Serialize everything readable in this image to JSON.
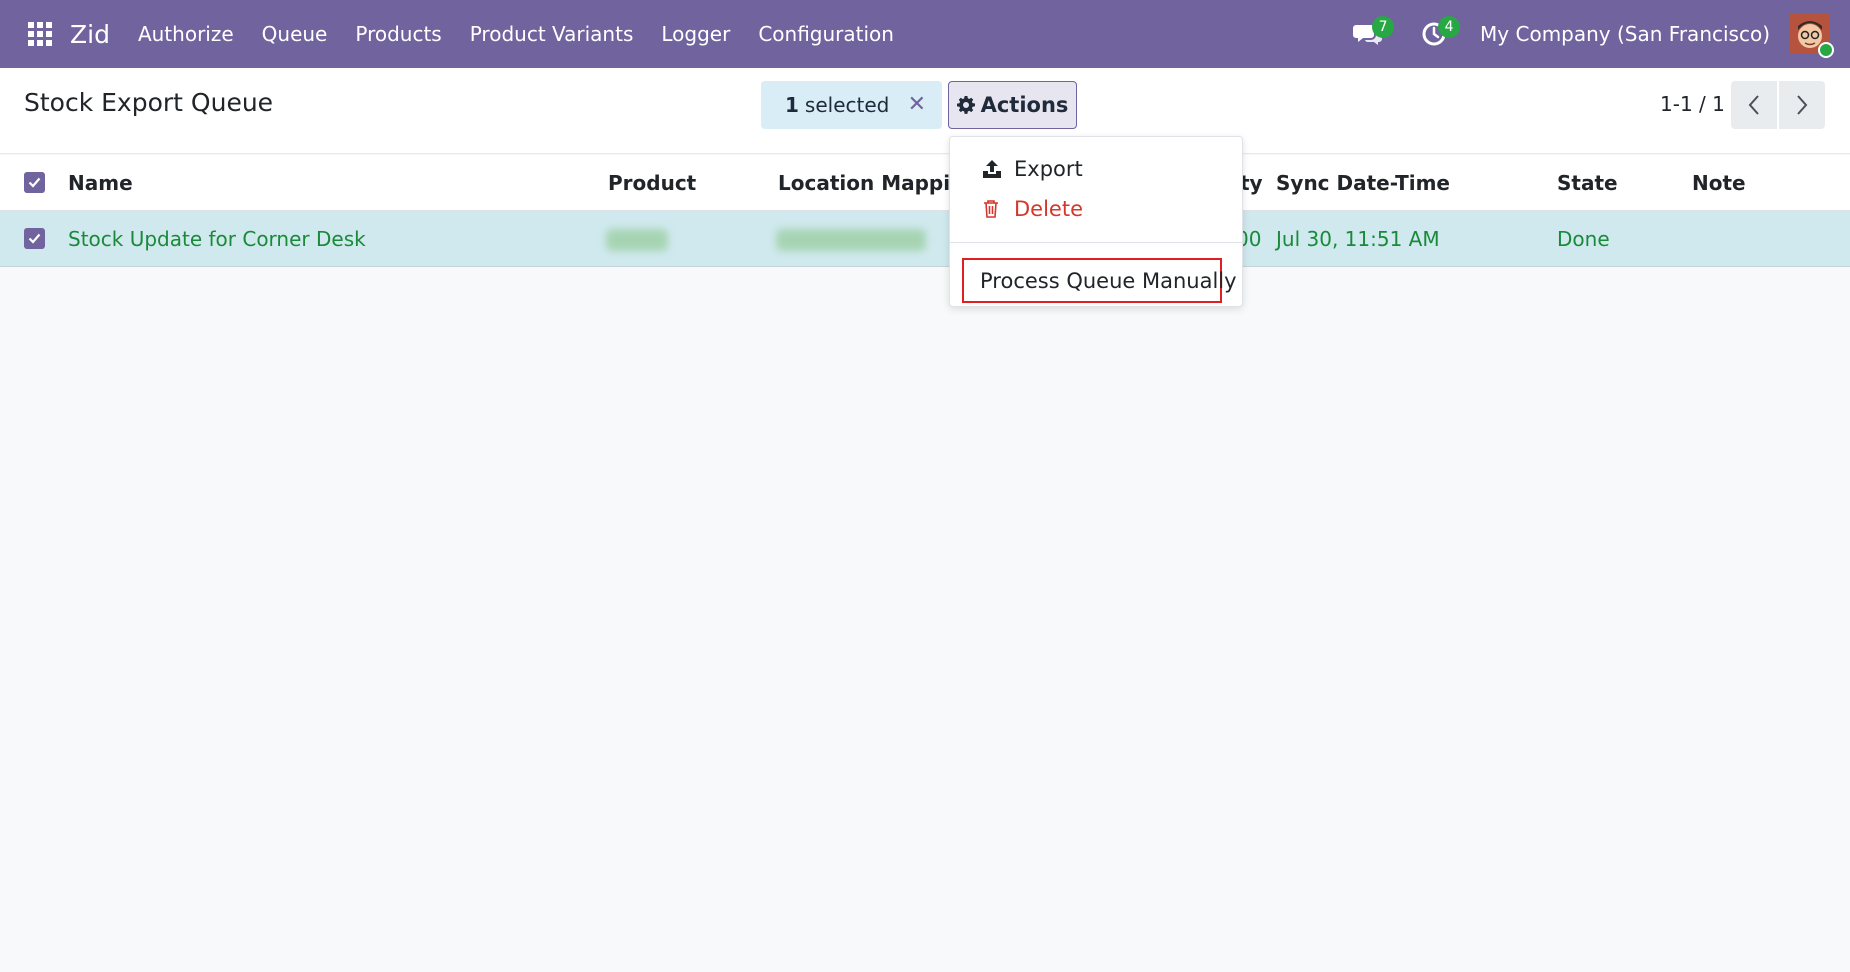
{
  "navbar": {
    "brand": "Zid",
    "menu": [
      "Authorize",
      "Queue",
      "Products",
      "Product Variants",
      "Logger",
      "Configuration"
    ],
    "messages_count": "7",
    "activities_count": "4",
    "company": "My Company (San Francisco)",
    "color": "#71639e"
  },
  "control_panel": {
    "title": "Stock Export Queue",
    "selected_count": "1",
    "selected_label": "selected",
    "actions_label": "Actions",
    "pager": "1-1 / 1"
  },
  "table": {
    "columns": {
      "name": "Name",
      "product": "Product",
      "location_mapping": "Location Mapping",
      "quantity_tail": "ty",
      "sync_date_time": "Sync Date-Time",
      "state": "State",
      "note": "Note"
    },
    "rows": [
      {
        "name": "Stock Update for Corner Desk",
        "quantity_tail": "00",
        "sync_date_time": "Jul 30, 11:51 AM",
        "state": "Done",
        "note": ""
      }
    ]
  },
  "actions_menu": {
    "items": [
      {
        "label": "Export",
        "icon": "upload-icon"
      },
      {
        "label": "Delete",
        "icon": "trash-icon"
      }
    ],
    "process_label": "Process Queue Manually"
  }
}
